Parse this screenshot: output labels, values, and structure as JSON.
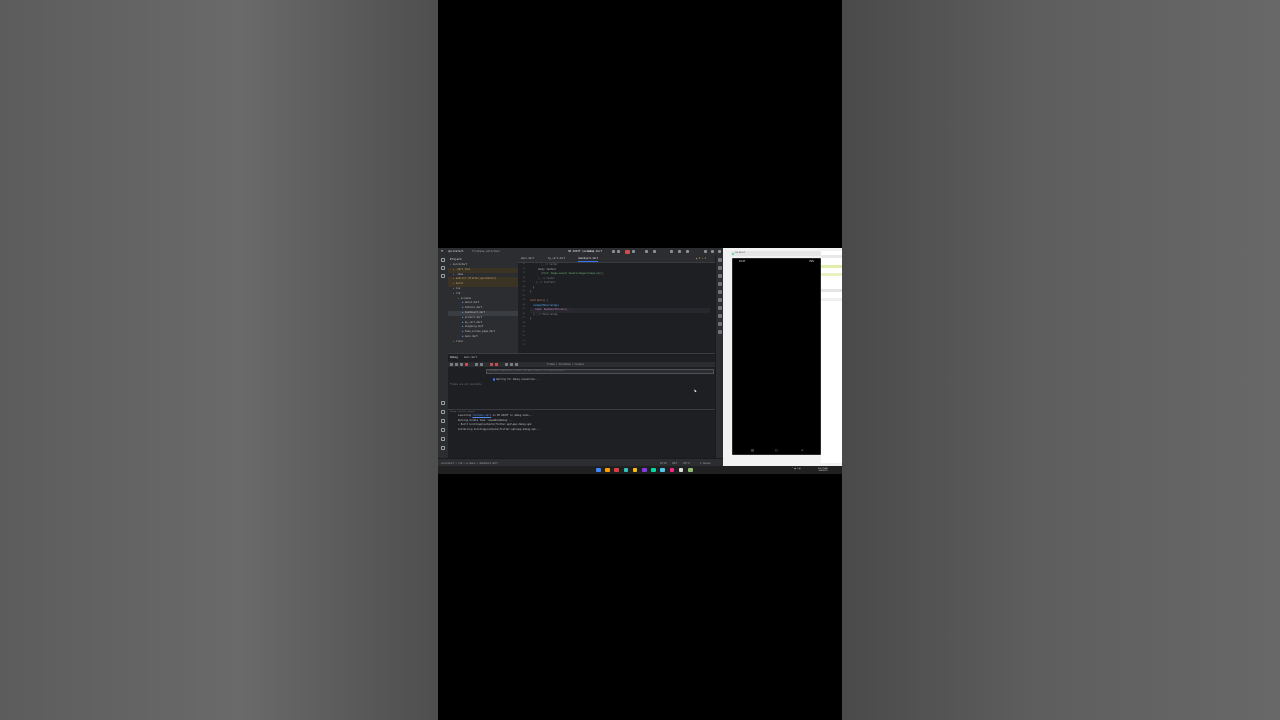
{
  "ide": {
    "project_name": "quickstart",
    "branch": "firebase_auth/main",
    "device": "SM A025F (mobile)",
    "run_config": "main.dart",
    "sidebar_title": "Project",
    "tree": [
      {
        "label": "quickstart",
        "kind": "root"
      },
      {
        "label": ".dart_tool",
        "kind": "folder-warn"
      },
      {
        "label": ".idea",
        "kind": "folder"
      },
      {
        "label": "android [flutter_quickstart]",
        "kind": "folder-warn"
      },
      {
        "label": "build",
        "kind": "folder-warn"
      },
      {
        "label": "ios",
        "kind": "folder"
      },
      {
        "label": "lib",
        "kind": "folder"
      },
      {
        "label": "screens",
        "kind": "folder"
      },
      {
        "label": "about.dart",
        "kind": "file"
      },
      {
        "label": "details.dart",
        "kind": "file"
      },
      {
        "label": "dashboard.dart",
        "kind": "file-active"
      },
      {
        "label": "product.dart",
        "kind": "file"
      },
      {
        "label": "my_cart.dart",
        "kind": "file"
      },
      {
        "label": "shopping.dart",
        "kind": "file"
      },
      {
        "label": "home_screen_page.dart",
        "kind": "file"
      },
      {
        "label": "main.dart",
        "kind": "file"
      },
      {
        "label": "linux",
        "kind": "folder"
      }
    ],
    "tabs": [
      {
        "label": "main.dart",
        "active": false
      },
      {
        "label": "my_cart.dart",
        "active": false
      },
      {
        "label": "dashboard.dart",
        "active": true
      }
    ],
    "line_numbers": [
      "35",
      "36",
      "37",
      "38",
      "39",
      "40",
      "41",
      "42",
      "43",
      "44",
      "45",
      "46",
      "47",
      "48",
      "49",
      "50",
      "51",
      "52",
      "53"
    ],
    "code": {
      "l1": "        ), // Center",
      "l2": "      body: Center(",
      "l3": "        child: Image.asset('assets/images/image.png'),",
      "l4": "      ), // Center",
      "l5": "    ); // Scaffold",
      "l6": "  }",
      "l7": "}",
      "l8": "void main() {",
      "l9": "  runApp(MaterialApp(",
      "l10": "    home: DashboardScreen(),",
      "l11": "  )); // MaterialApp",
      "l12": "}"
    },
    "warnings": "▲ 5 ✕ 2",
    "debug": {
      "title": "Debug",
      "session": "main.dart",
      "frames_label": "Frames | Variables | Console",
      "evaluate_placeholder": "Evaluate expression (Enter) or add a watch (Ctrl+Shift+Enter)",
      "frames_empty": "Frames are not available",
      "waiting": "Waiting for debug connection..."
    },
    "console": {
      "header": "Debug console output",
      "lines": [
        {
          "pre": "Launching ",
          "link": "lib\\main.dart",
          "post": " on SM A025F in debug mode..."
        },
        {
          "pre": "Running Gradle task 'assembleDebug'...",
          "link": "",
          "post": ""
        },
        {
          "pre": "✓ Built build\\app\\outputs\\flutter-apk\\app-debug.apk",
          "link": "",
          "post": ""
        },
        {
          "pre": "Installing build\\app\\outputs\\flutter-apk\\app-debug.apk...",
          "link": "",
          "post": ""
        }
      ]
    },
    "status": {
      "path": "quickstart > lib > screens > dashboard.dart",
      "position": "48:29",
      "line_sep": "CRLF",
      "encoding": "UTF-8",
      "indent": "2 spaces"
    }
  },
  "emulator": {
    "window_title": "SM A025F",
    "time": "10:27",
    "battery": "76%",
    "nav": [
      "|||",
      "○",
      "<"
    ]
  },
  "taskbar": {
    "time": "10:27 AM",
    "date": "3/4/2023",
    "app_colors": [
      "#3a86ff",
      "#ff9e00",
      "#e63946",
      "#2ec4b6",
      "#ffbe0b",
      "#8338ec",
      "#06d6a0",
      "#4cc9f0",
      "#f72585",
      "#dddddd",
      "#90be6d"
    ]
  },
  "colors": {
    "ide_bg": "#1e1f22",
    "panel_bg": "#2b2d30",
    "accent": "#3574f0",
    "stop_red": "#c94f4f"
  }
}
